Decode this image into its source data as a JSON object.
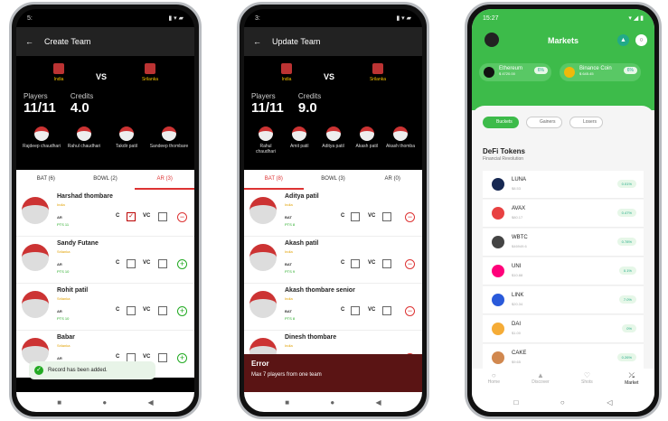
{
  "phone1": {
    "status": {
      "time": "5:",
      "rest": "M",
      "icons": "▮ ▾ ▰"
    },
    "title": "Create Team",
    "team_a": "India",
    "team_b": "Srilanka",
    "vs": "VS",
    "players_label": "Players",
    "players_value": "11/11",
    "credits_label": "Credits",
    "credits_value": "4.0",
    "top_players": [
      "Rajdeep chaudhari",
      "Rahul chaudhari",
      "Takdir patil",
      "Sandeep thombare"
    ],
    "tabs": [
      "BAT (6)",
      "BOWL (2)",
      "AR (3)"
    ],
    "rows": [
      {
        "name": "Harshad thombare",
        "team": "India",
        "role": "AR",
        "pts": "PTS 11",
        "c_checked": true,
        "action": "−"
      },
      {
        "name": "Sandy Futane",
        "team": "Srilanka",
        "role": "AR",
        "pts": "PTS 10",
        "c_checked": false,
        "action": "+"
      },
      {
        "name": "Rohit patil",
        "team": "Srilanka",
        "role": "AR",
        "pts": "PTS 10",
        "c_checked": false,
        "action": "+"
      },
      {
        "name": "Babar",
        "team": "Srilanka",
        "role": "AR",
        "pts": "PTS 10",
        "c_checked": false,
        "action": "+"
      }
    ],
    "c_label": "C",
    "vc_label": "VC",
    "toast": "Record has been added."
  },
  "phone2": {
    "status": {
      "time": "3:",
      "rest": "M",
      "icons": "▮ ▾ ▰"
    },
    "title": "Update Team",
    "team_a": "India",
    "team_b": "Srilanka",
    "vs": "VS",
    "players_label": "Players",
    "players_value": "11/11",
    "credits_label": "Credits",
    "credits_value": "9.0",
    "top_players": [
      "Rahul chaudhari",
      "Amit patil",
      "Aditya patil",
      "Akash patil",
      "Akash thomba"
    ],
    "tabs": [
      "BAT (8)",
      "BOWL (3)",
      "AR (0)"
    ],
    "rows": [
      {
        "name": "Aditya patil",
        "team": "India",
        "role": "BAT",
        "pts": "PTS 8",
        "action": "−"
      },
      {
        "name": "Akash patil",
        "team": "India",
        "role": "BAT",
        "pts": "PTS 9",
        "action": "−"
      },
      {
        "name": "Akash thombare senior",
        "team": "India",
        "role": "BAT",
        "pts": "PTS 8",
        "action": "−"
      },
      {
        "name": "Dinesh thombare",
        "team": "India",
        "role": "BAT",
        "pts": "PTS 8",
        "action": "−"
      }
    ],
    "c_label": "C",
    "vc_label": "VC",
    "error_title": "Error",
    "error_msg": "Max 7 players from one team"
  },
  "phone3": {
    "status": {
      "time": "15:27",
      "icons": "▾ ◢ ▮"
    },
    "title": "Markets",
    "pills": [
      {
        "name": "Ethereum",
        "sub": "$ 4720.00",
        "pct": "6%"
      },
      {
        "name": "Binance Coin",
        "sub": "$ 645.45",
        "pct": "6%"
      }
    ],
    "filters": [
      "Buckets",
      "Gainers",
      "Losers"
    ],
    "section": "DeFi Tokens",
    "section_sub": "Financial Revolution",
    "tokens": [
      {
        "name": "LUNA",
        "sub": "$8.53",
        "pct": "0.01%",
        "color": "#172852"
      },
      {
        "name": "AVAX",
        "sub": "$80.17",
        "pct": "0.47%",
        "color": "#e84142"
      },
      {
        "name": "WBTC",
        "sub": "$46949.6",
        "pct": "0.78%",
        "color": "#444444"
      },
      {
        "name": "UNI",
        "sub": "$10.88",
        "pct": "0.1%",
        "color": "#ff007a"
      },
      {
        "name": "LINK",
        "sub": "$20.34",
        "pct": "7.0%",
        "color": "#2a5ada"
      },
      {
        "name": "DAI",
        "sub": "$1.00",
        "pct": "0%",
        "color": "#f5ac37"
      },
      {
        "name": "CAKE",
        "sub": "$9.65",
        "pct": "0.26%",
        "color": "#d1884f"
      }
    ],
    "bottom_nav": [
      "Home",
      "Discover",
      "Shots",
      "Market"
    ]
  },
  "colors": {
    "accent_red": "#d33333",
    "accent_green": "#3dbb4a"
  }
}
